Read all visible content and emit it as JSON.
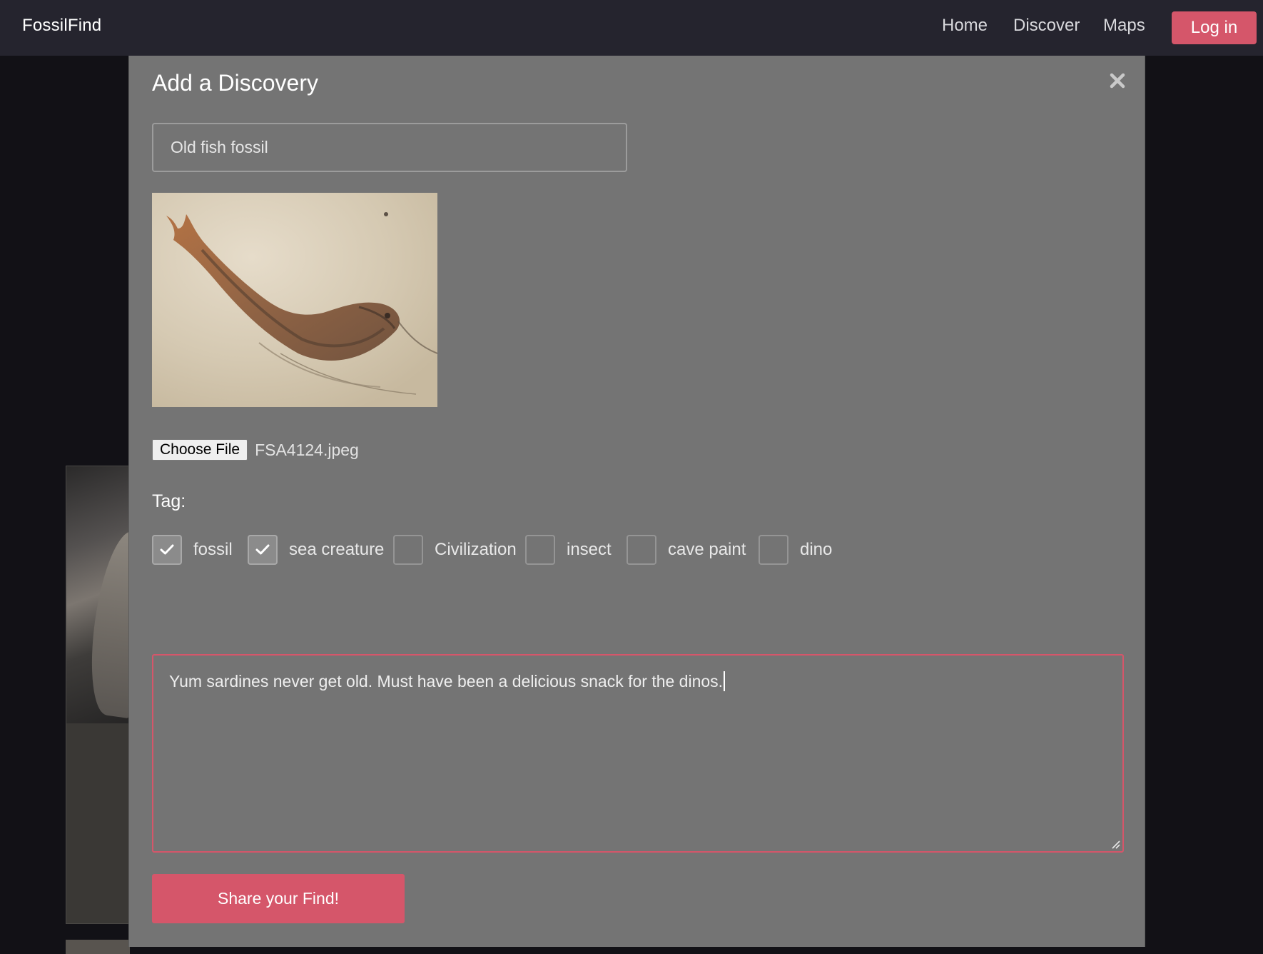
{
  "app": {
    "brand": "FossilFind"
  },
  "nav": {
    "items": [
      {
        "label": "Home"
      },
      {
        "label": "Discover"
      },
      {
        "label": "Maps"
      }
    ],
    "login_label": "Log in"
  },
  "modal": {
    "title": "Add a Discovery",
    "close_icon": "close-icon",
    "title_input": {
      "value": "Old fish fossil",
      "placeholder": ""
    },
    "preview_image": "fish-fossil-photo",
    "file": {
      "button_label": "Choose File",
      "file_name": "FSA4124.jpeg"
    },
    "tag_label": "Tag:",
    "tags": [
      {
        "label": "fossil",
        "checked": true
      },
      {
        "label": "sea creature",
        "checked": true
      },
      {
        "label": "Civilization",
        "checked": false
      },
      {
        "label": "insect",
        "checked": false
      },
      {
        "label": "cave paint",
        "checked": false
      },
      {
        "label": "dino",
        "checked": false
      }
    ],
    "description": "Yum sardines never get old. Must have been a delicious snack for the dinos.",
    "submit_label": "Share your Find!"
  },
  "colors": {
    "accent": "#d5566a",
    "navbar_bg": "#25242e",
    "modal_bg": "#747474",
    "page_bg": "#121116"
  }
}
